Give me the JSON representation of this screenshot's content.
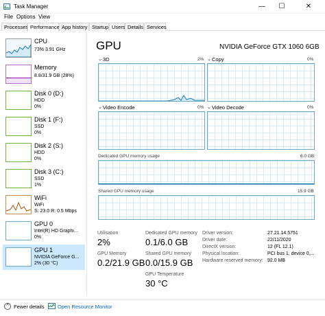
{
  "window": {
    "title": "Task Manager",
    "minimize_glyph": "—",
    "maximize_glyph": "☐",
    "close_glyph": "✕"
  },
  "menu": [
    "File",
    "Options",
    "View"
  ],
  "tabs": [
    "Processes",
    "Performance",
    "App history",
    "Startup",
    "Users",
    "Details",
    "Services"
  ],
  "active_tab": "Performance",
  "sidebar": {
    "items": [
      {
        "label": "CPU",
        "sub1": "73%  3.91 GHz",
        "sub2": "",
        "color": "#117dbb"
      },
      {
        "label": "Memory",
        "sub1": "8.8/31.9 GB (28%)",
        "sub2": "",
        "color": "#8b12ae"
      },
      {
        "label": "Disk 0 (D:)",
        "sub1": "HDD",
        "sub2": "0%",
        "color": "#4da60c"
      },
      {
        "label": "Disk 1 (F:)",
        "sub1": "SSD",
        "sub2": "0%",
        "color": "#4da60c"
      },
      {
        "label": "Disk 2 (S:)",
        "sub1": "HDD",
        "sub2": "0%",
        "color": "#4da60c"
      },
      {
        "label": "Disk 3 (C:)",
        "sub1": "SSD",
        "sub2": "1%",
        "color": "#4da60c"
      },
      {
        "label": "WiFi",
        "sub1": "WiFi",
        "sub2": "S: 23.0  R: 0.5 Mbps",
        "color": "#a74f01"
      },
      {
        "label": "GPU 0",
        "sub1": "Intel(R) HD Graphi...",
        "sub2": "0%",
        "color": "#117dbb"
      },
      {
        "label": "GPU 1",
        "sub1": "NVIDIA GeForce G...",
        "sub2": "2% (30 °C)",
        "color": "#117dbb"
      }
    ],
    "selected_index": 8
  },
  "main": {
    "title": "GPU",
    "gpu_name": "NVIDIA GeForce GTX 1060 6GB",
    "engines": [
      {
        "label": "3D",
        "pct": "2%"
      },
      {
        "label": "Copy",
        "pct": "0%"
      },
      {
        "label": "Video Encode",
        "pct": "0%"
      },
      {
        "label": "Video Decode",
        "pct": "0%"
      }
    ],
    "dedicated_label": "Dedicated GPU memory usage",
    "dedicated_max": "6.0 GB",
    "shared_label": "Shared GPU memory usage",
    "shared_max": "15.9 GB",
    "stats": {
      "utilisation_label": "Utilisation",
      "utilisation_value": "2%",
      "dedicated_mem_label": "Dedicated GPU memory",
      "dedicated_mem_value": "0.1/6.0 GB",
      "gpu_memory_label": "GPU Memory",
      "gpu_memory_value": "0.2/21.9 GB",
      "shared_mem_label": "Shared GPU memory",
      "shared_mem_value": "0.0/15.9 GB",
      "temperature_label": "GPU Temperature",
      "temperature_value": "30 °C"
    },
    "info": [
      {
        "key": "Driver version:",
        "value": "27.21.14.5751"
      },
      {
        "key": "Driver date:",
        "value": "22/11/2020"
      },
      {
        "key": "DirectX version:",
        "value": "12 (FL 12.1)"
      },
      {
        "key": "Physical location:",
        "value": "PCI bus 1, device 0,..."
      },
      {
        "key": "Hardware reserved memory:",
        "value": "92.0 MB"
      }
    ]
  },
  "footer": {
    "fewer_details": "Fewer details",
    "open_resource_monitor": "Open Resource Monitor"
  }
}
